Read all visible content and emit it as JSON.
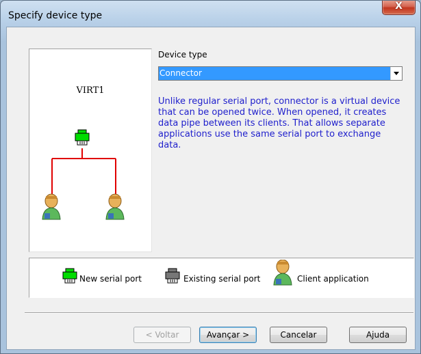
{
  "window": {
    "title": "Specify device type",
    "close_label": "X"
  },
  "diagram": {
    "port_name": "VIRT1"
  },
  "device_type": {
    "label": "Device type",
    "selected": "Connector",
    "description": "Unlike regular serial port, connector is a virtual device that can be opened twice. When opened, it creates data pipe between its clients. That allows separate applications use the same serial port to exchange data."
  },
  "legend": {
    "new_port": "New serial port",
    "existing_port": "Existing serial port",
    "client_app": "Client application"
  },
  "buttons": {
    "back": "< Voltar",
    "next": "Avançar >",
    "cancel": "Cancelar",
    "help": "Ajuda"
  },
  "colors": {
    "new_port": "#00dd00",
    "existing_port": "#777777",
    "link": "#e00000",
    "description_text": "#1e1ecc",
    "selection": "#3399ff"
  }
}
